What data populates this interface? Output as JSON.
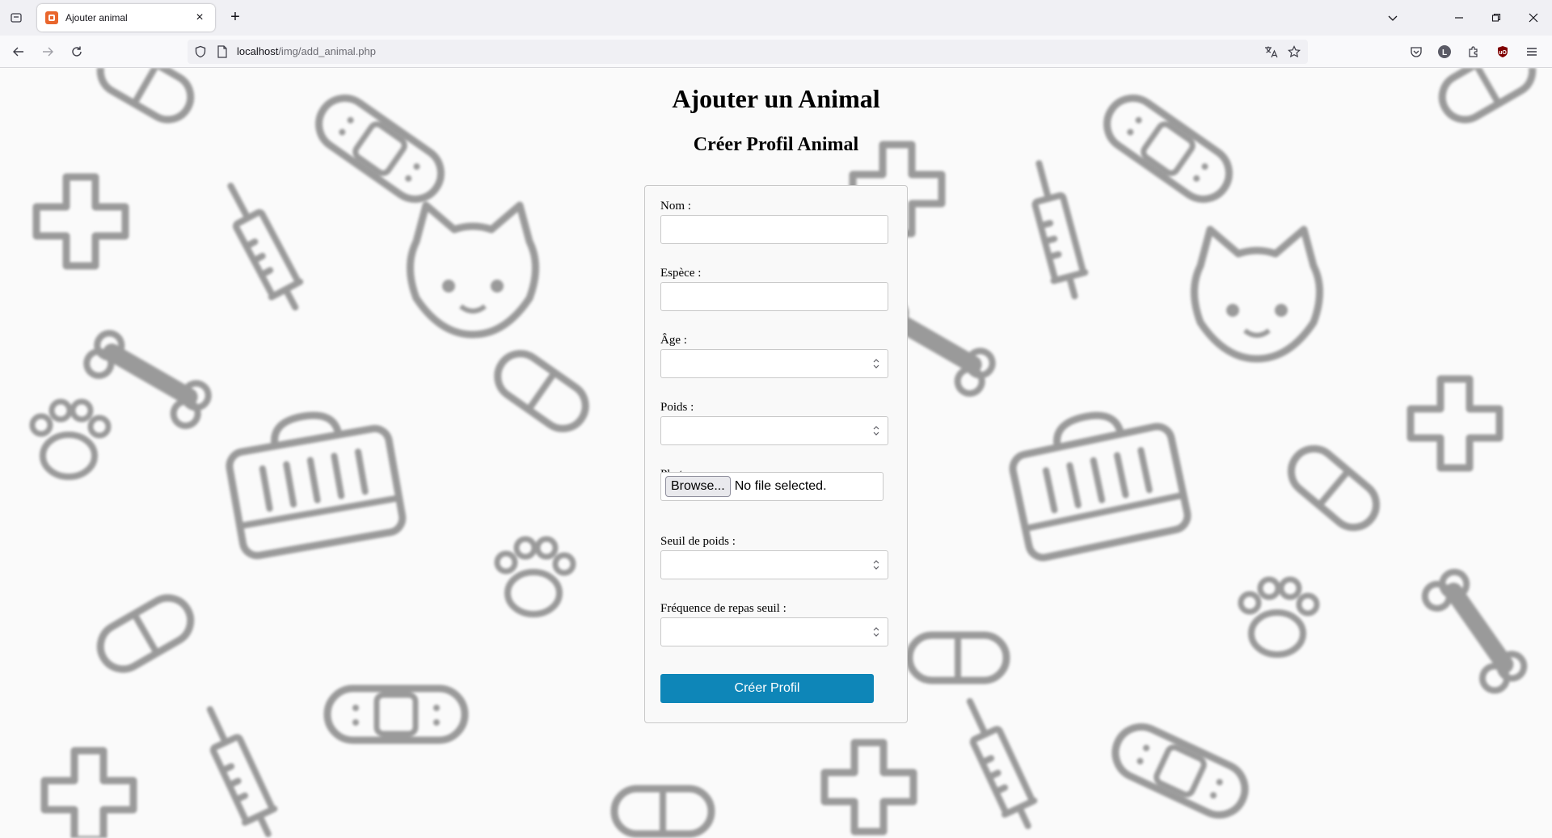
{
  "browser": {
    "tab_title": "Ajouter animal",
    "url_host": "localhost",
    "url_path": "/img/add_animal.php"
  },
  "page": {
    "title": "Ajouter un Animal",
    "subtitle": "Créer Profil Animal"
  },
  "form": {
    "name_label": "Nom :",
    "name_value": "",
    "species_label": "Espèce :",
    "species_value": "",
    "age_label": "Âge :",
    "age_value": "",
    "weight_label": "Poids :",
    "weight_value": "",
    "photo_label": "Photo :",
    "browse_label": "Browse...",
    "file_status": "No file selected.",
    "weight_threshold_label": "Seuil de poids :",
    "weight_threshold_value": "",
    "meal_frequency_label": "Fréquence de repas seuil :",
    "meal_frequency_value": "",
    "submit_label": "Créer Profil"
  },
  "icons": {
    "tab_list": "tab-list-icon",
    "favicon": "xampp-favicon",
    "close": "close-icon",
    "new_tab": "plus-icon",
    "back": "back-arrow-icon",
    "forward": "forward-arrow-icon",
    "reload": "reload-icon",
    "shield": "shield-icon",
    "page": "page-icon",
    "translate": "translate-icon",
    "bookmark": "star-icon",
    "pocket": "pocket-icon",
    "account": "account-icon",
    "extensions": "extensions-icon",
    "ublock": "ublock-icon",
    "menu": "hamburger-menu-icon"
  },
  "colors": {
    "submit_button": "#0e86b8",
    "background_pattern": "#9a9a9a"
  }
}
